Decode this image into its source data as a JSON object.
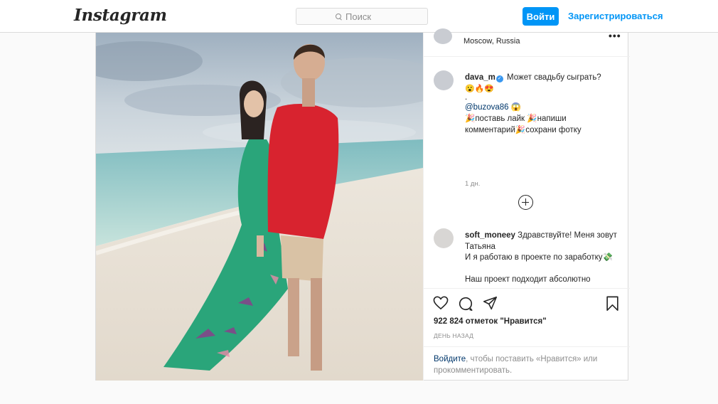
{
  "header": {
    "logo": "Instagram",
    "search_placeholder": "Поиск",
    "login_label": "Войти",
    "signup_label": "Зарегистрироваться"
  },
  "post": {
    "location": "Moscow, Russia",
    "caption": {
      "username": "dava_m",
      "text": "Может свадьбу сыграть?",
      "emojis": "😮🔥😍",
      "dot": ".",
      "mention": "@buzova86",
      "mention_emoji": "😱",
      "line1": "🎉поставь лайк 🎉напиши",
      "line2": "комментарий🎉сохрани фотку",
      "time": "1 дн."
    },
    "comment": {
      "username": "soft_moneey",
      "text": "Здравствуйте! Меня зовут Татьяна\nИ я работаю в проекте по заработку💸\n\nНаш проект подходит абсолютно каждому, неважно откуда"
    },
    "likes": "922 824 отметок \"Нравится\"",
    "ago": "ДЕНЬ НАЗАД",
    "login_prompt": {
      "link": "Войдите",
      "rest": ", чтобы поставить «Нравится» или прокомментировать."
    }
  },
  "colors": {
    "accent": "#0095f6",
    "dress": "#2aa57a",
    "shirt": "#d8232f",
    "sand": "#efe8dd",
    "sea": "#a6d2cc"
  }
}
